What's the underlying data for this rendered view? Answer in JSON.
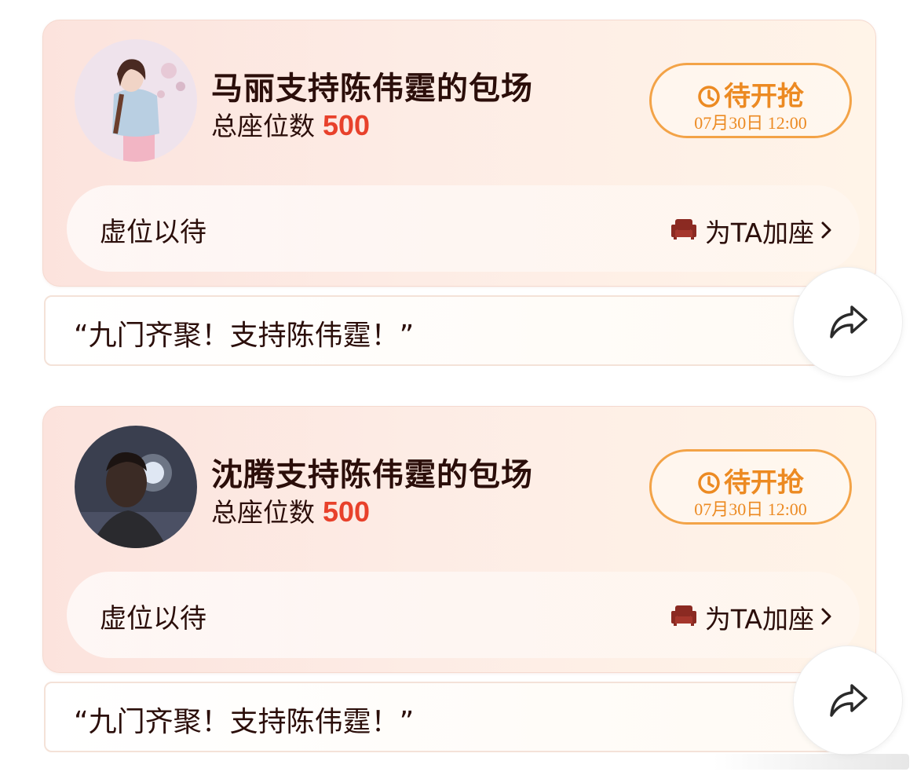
{
  "cards": [
    {
      "title": "马丽支持陈伟霆的包场",
      "seats_label": "总座位数",
      "seats_value": "500",
      "status_label": "待开抢",
      "status_time": "07月30日 12:00",
      "placeholder_text": "虚位以待",
      "add_seat_label": "为TA加座",
      "quote": "“九门齐聚！支持陈伟霆！”",
      "avatar_icon": "avatar-photo-woman",
      "share_icon": "share-arrow-icon"
    },
    {
      "title": "沈腾支持陈伟霆的包场",
      "seats_label": "总座位数",
      "seats_value": "500",
      "status_label": "待开抢",
      "status_time": "07月30日 12:00",
      "placeholder_text": "虚位以待",
      "add_seat_label": "为TA加座",
      "quote": "“九门齐聚！支持陈伟霆！”",
      "avatar_icon": "avatar-photo-man",
      "share_icon": "share-arrow-icon"
    }
  ],
  "colors": {
    "title_text": "#2b0e0a",
    "seat_number": "#e8412b",
    "status_orange": "#ec8a22",
    "card_bg_start": "#fce3dd",
    "card_bg_end": "#fff4e8",
    "sofa_icon": "#8b2a22"
  }
}
